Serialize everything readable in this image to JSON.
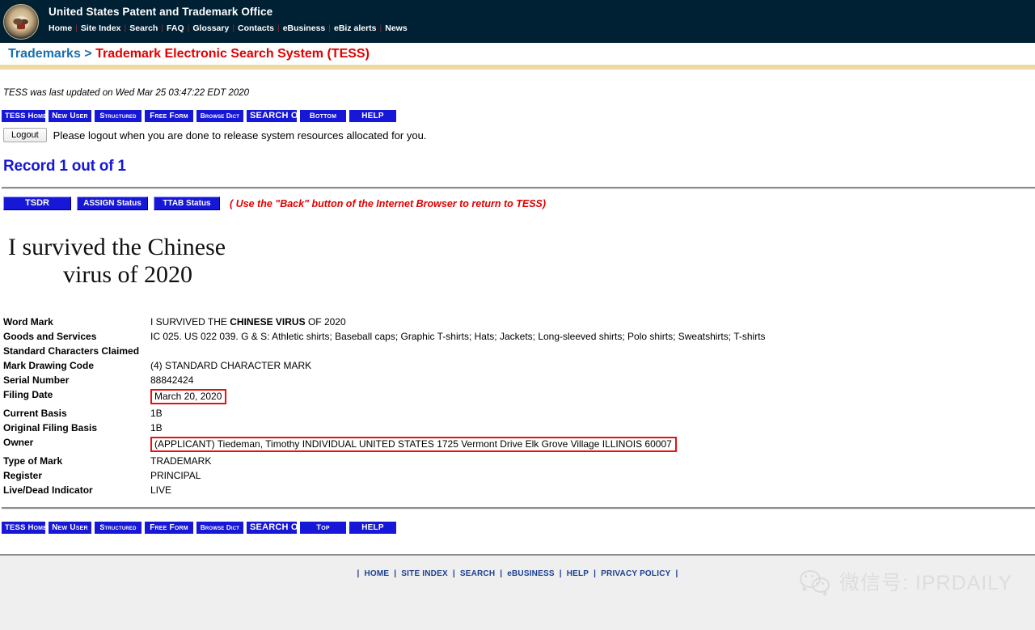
{
  "header": {
    "agency_title": "United States Patent and Trademark Office",
    "seal_icon": "uspto-seal-icon",
    "nav_links": [
      "Home",
      "Site Index",
      "Search",
      "FAQ",
      "Glossary",
      "Contacts",
      "eBusiness",
      "eBiz alerts",
      "News"
    ],
    "nav_separator": "|"
  },
  "breadcrumb": {
    "parent": "Trademarks",
    "separator": ">",
    "current": "Trademark Electronic Search System (TESS)",
    "parent_color": "#1a6faf",
    "current_color": "#e00000"
  },
  "status": {
    "updated_line": "TESS was last updated on Wed Mar 25 03:47:22 EDT 2020"
  },
  "toolbar_top": {
    "buttons": [
      {
        "label": "TESS Home",
        "name": "tess-home-button"
      },
      {
        "label": "New User",
        "name": "new-user-button"
      },
      {
        "label": "Structured",
        "name": "structured-button"
      },
      {
        "label": "Free Form",
        "name": "free-form-button"
      },
      {
        "label": "Browse Dict",
        "name": "browse-dict-button"
      },
      {
        "label": "SEARCH OG",
        "name": "search-og-button"
      },
      {
        "label": "Bottom",
        "name": "bottom-button"
      },
      {
        "label": "HELP",
        "name": "help-button"
      }
    ]
  },
  "toolbar_bottom": {
    "buttons": [
      {
        "label": "TESS Home",
        "name": "tess-home-button"
      },
      {
        "label": "New User",
        "name": "new-user-button"
      },
      {
        "label": "Structured",
        "name": "structured-button"
      },
      {
        "label": "Free Form",
        "name": "free-form-button"
      },
      {
        "label": "Browse Dict",
        "name": "browse-dict-button"
      },
      {
        "label": "SEARCH OG",
        "name": "search-og-button"
      },
      {
        "label": "Top",
        "name": "top-button"
      },
      {
        "label": "HELP",
        "name": "help-button"
      }
    ]
  },
  "logout": {
    "button_label": "Logout",
    "notice": "Please logout when you are done to release system resources allocated for you."
  },
  "record": {
    "heading": "Record 1 out of 1",
    "status_buttons": [
      {
        "label": "TSDR",
        "name": "tsdr-button"
      },
      {
        "label": "ASSIGN Status",
        "name": "assign-status-button"
      },
      {
        "label": "TTAB Status",
        "name": "ttab-status-button"
      }
    ],
    "back_note": "( Use the \"Back\" button of the Internet Browser to return to TESS)"
  },
  "mark_image": {
    "line1": "I survived the Chinese",
    "line2": "virus of 2020"
  },
  "fields": [
    {
      "label": "Word Mark",
      "value_pre": "I SURVIVED THE ",
      "value_bold": "CHINESE VIRUS",
      "value_post": " OF 2020",
      "highlighted": false
    },
    {
      "label": "Goods and Services",
      "value": "IC 025. US 022 039. G & S: Athletic shirts; Baseball caps; Graphic T-shirts; Hats; Jackets; Long-sleeved shirts; Polo shirts; Sweatshirts; T-shirts",
      "highlighted": false
    },
    {
      "label": "Standard Characters Claimed",
      "value": "",
      "highlighted": false
    },
    {
      "label": "Mark Drawing Code",
      "value": "(4) STANDARD CHARACTER MARK",
      "highlighted": false
    },
    {
      "label": "Serial Number",
      "value": "88842424",
      "highlighted": false
    },
    {
      "label": "Filing Date",
      "value": "March 20, 2020",
      "highlighted": true
    },
    {
      "label": "Current Basis",
      "value": "1B",
      "highlighted": false
    },
    {
      "label": "Original Filing Basis",
      "value": "1B",
      "highlighted": false
    },
    {
      "label": "Owner",
      "value": "(APPLICANT) Tiedeman, Timothy INDIVIDUAL UNITED STATES 1725 Vermont Drive Elk Grove Village ILLINOIS 60007",
      "highlighted": true
    },
    {
      "label": "Type of Mark",
      "value": "TRADEMARK",
      "highlighted": false
    },
    {
      "label": "Register",
      "value": "PRINCIPAL",
      "highlighted": false
    },
    {
      "label": "Live/Dead Indicator",
      "value": "LIVE",
      "highlighted": false
    }
  ],
  "footer": {
    "links": [
      "HOME",
      "SITE INDEX",
      "SEARCH",
      "eBUSINESS",
      "HELP",
      "PRIVACY POLICY"
    ],
    "separator": "|",
    "link_color": "#1b3f8f"
  },
  "watermark": {
    "icon": "wechat-icon",
    "text": "微信号: IPRDAILY"
  },
  "colors": {
    "header_bg": "#002033",
    "gold_bar": "#ecdaa5",
    "button_blue": "#1717d8",
    "highlight_red": "#e81010",
    "footer_bg": "#efefef"
  }
}
